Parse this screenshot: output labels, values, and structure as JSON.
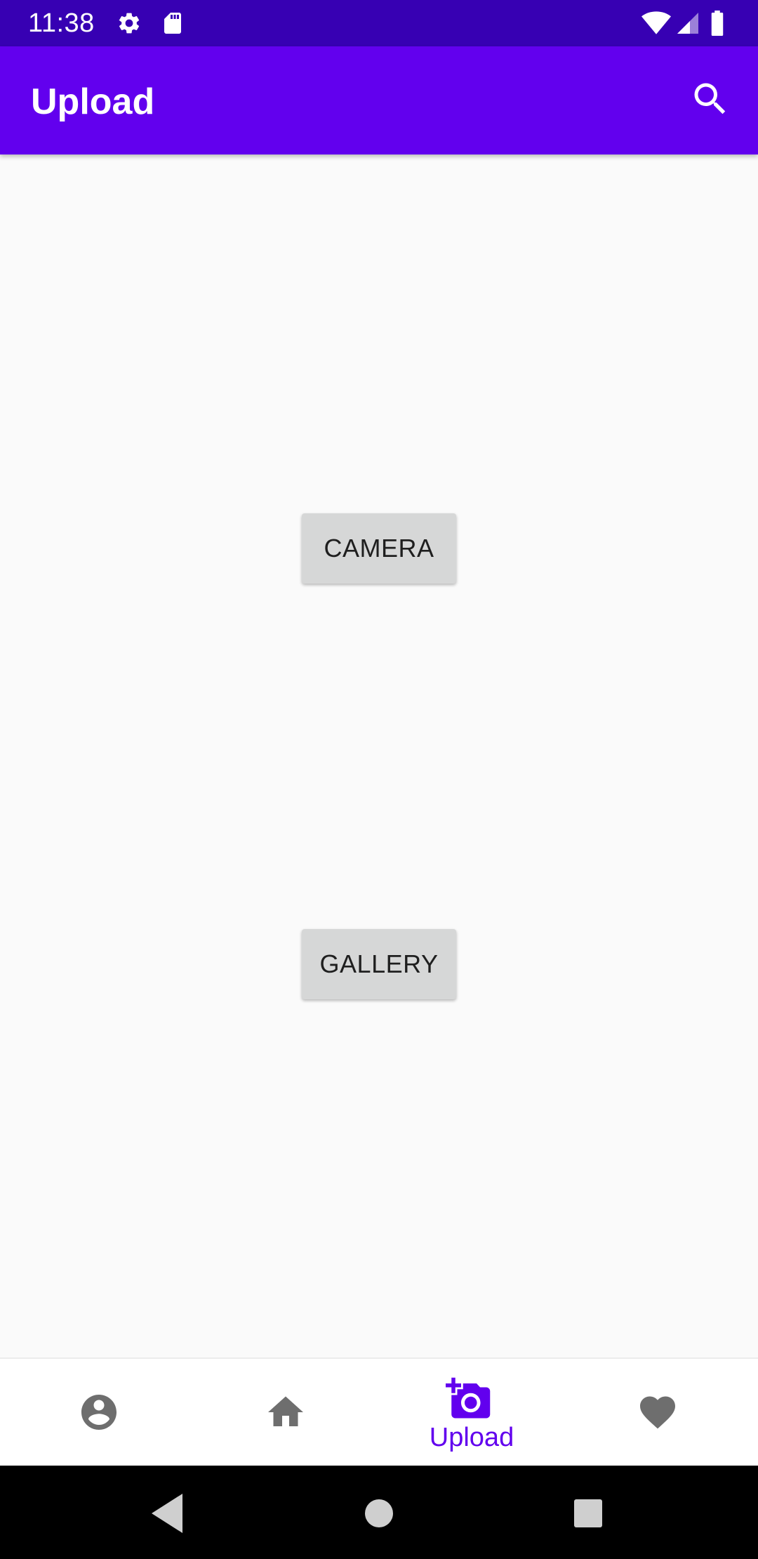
{
  "status_bar": {
    "time": "11:38",
    "icons": [
      "settings-icon",
      "sd-card-icon",
      "wifi-icon",
      "signal-icon",
      "battery-icon"
    ],
    "background": "#3700b3"
  },
  "app_bar": {
    "title": "Upload",
    "background": "#6200ee",
    "actions": [
      "search-icon"
    ]
  },
  "main": {
    "camera_button": "CAMERA",
    "gallery_button": "GALLERY",
    "button_background": "#d6d7d7"
  },
  "bottom_nav": {
    "active_color": "#6200ee",
    "inactive_color": "#6e6e6e",
    "items": [
      {
        "icon": "account-circle-icon",
        "label": "",
        "active": false
      },
      {
        "icon": "home-icon",
        "label": "",
        "active": false
      },
      {
        "icon": "add-a-photo-icon",
        "label": "Upload",
        "active": true
      },
      {
        "icon": "heart-icon",
        "label": "",
        "active": false
      }
    ]
  },
  "system_nav": {
    "buttons": [
      "back-icon",
      "home-circle-icon",
      "recents-icon"
    ]
  }
}
